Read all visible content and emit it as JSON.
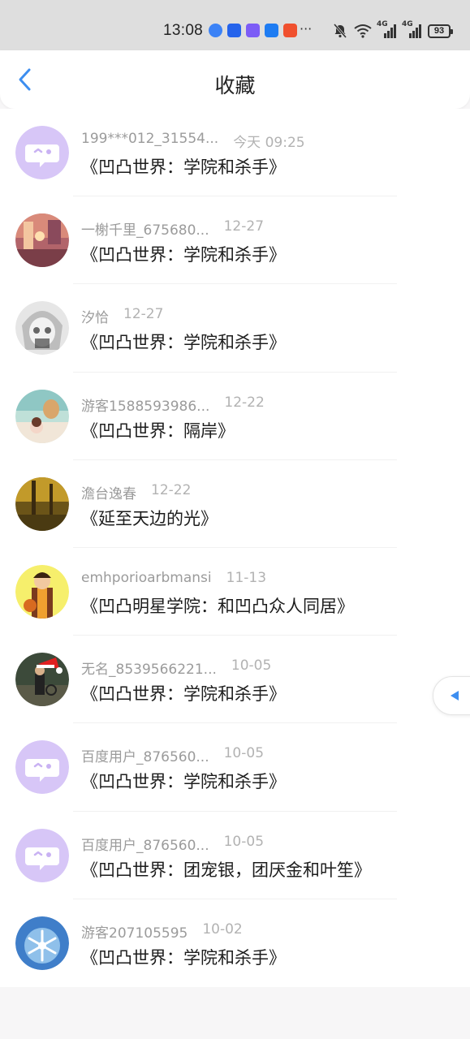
{
  "status_bar": {
    "time": "13:08",
    "more": "···",
    "net_1": "4G",
    "net_2": "4G",
    "battery": "93",
    "app_colors": [
      "#3b82f6",
      "#2563eb",
      "#7c5cf6",
      "#1e7cf2",
      "#f0502e"
    ]
  },
  "header": {
    "title": "收藏"
  },
  "colors": {
    "accent": "#3d8ef0",
    "default_avatar_bg": "#d7c6f7",
    "default_avatar_fg": "#ffffff"
  },
  "items": [
    {
      "name": "199***012_31554...",
      "time": "今天 09:25",
      "book": "《凹凸世界：学院和杀手》",
      "avatar": "bubble-face-icon"
    },
    {
      "name": "一榭千里_675680...",
      "time": "12-27",
      "book": "《凹凸世界：学院和杀手》",
      "avatar": "photo-room"
    },
    {
      "name": "汐恰",
      "time": "12-27",
      "book": "《凹凸世界：学院和杀手》",
      "avatar": "photo-anime-gray"
    },
    {
      "name": "游客1588593986...",
      "time": "12-22",
      "book": "《凹凸世界：隔岸》",
      "avatar": "photo-deer"
    },
    {
      "name": "澹台逸春",
      "time": "12-22",
      "book": "《延至天边的光》",
      "avatar": "photo-forest"
    },
    {
      "name": "emhporioarbmansi",
      "time": "11-13",
      "book": "《凹凸明星学院：和凹凸众人同居》",
      "avatar": "photo-player"
    },
    {
      "name": "无名_8539566221...",
      "time": "10-05",
      "book": "《凹凸世界：学院和杀手》",
      "avatar": "photo-santa"
    },
    {
      "name": "百度用户_876560...",
      "time": "10-05",
      "book": "《凹凸世界：学院和杀手》",
      "avatar": "bubble-face-icon"
    },
    {
      "name": "百度用户_876560...",
      "time": "10-05",
      "book": "《凹凸世界：团宠银，团厌金和叶笙》",
      "avatar": "bubble-face-icon"
    },
    {
      "name": "游客207105595",
      "time": "10-02",
      "book": "《凹凸世界：学院和杀手》",
      "avatar": "photo-snowflake"
    }
  ]
}
